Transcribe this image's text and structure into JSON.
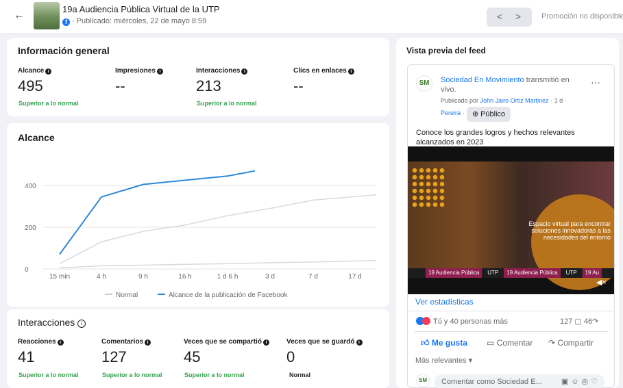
{
  "header": {
    "back": "←",
    "title": "19a Audiencia Pública Virtual de la UTP",
    "meta": "· Publicado: miércoles, 22 de mayo 8:59",
    "prev": "<",
    "next": ">",
    "promo": "Promoción no disponible"
  },
  "general": {
    "title": "Información general",
    "metrics": [
      {
        "label": "Alcance",
        "value": "495",
        "badge": "Superior a lo normal"
      },
      {
        "label": "Impresiones",
        "value": "--",
        "badge": ""
      },
      {
        "label": "Interacciones",
        "value": "213",
        "badge": "Superior a lo normal"
      },
      {
        "label": "Clics en enlaces",
        "value": "--",
        "badge": ""
      }
    ]
  },
  "reach_chart": {
    "title": "Alcance",
    "legend_normal": "Normal",
    "legend_post": "Alcance de la publicación de Facebook"
  },
  "chart_data": {
    "type": "line",
    "title": "Alcance",
    "categories": [
      "15 min",
      "4 h",
      "9 h",
      "16 h",
      "1 d 6 h",
      "3 d",
      "7 d",
      "17 d"
    ],
    "y_ticks": [
      "0",
      "200",
      "400"
    ],
    "ylim": [
      0,
      500
    ],
    "colors": {
      "post": "#2d88d8",
      "normal": "#d8dadf"
    },
    "series": [
      {
        "name": "Alcance de la publicación de Facebook",
        "values": [
          70,
          345,
          405,
          425,
          445,
          470,
          null,
          null
        ]
      },
      {
        "name": "Normal",
        "values": [
          25,
          130,
          180,
          210,
          255,
          290,
          330,
          355
        ]
      },
      {
        "name": "Normal",
        "values": [
          5,
          15,
          18,
          22,
          25,
          30,
          33,
          40
        ]
      }
    ]
  },
  "interactions": {
    "title": "Interacciones",
    "metrics": [
      {
        "label": "Reacciones",
        "value": "41",
        "badge": "Superior a lo normal",
        "neutral": false
      },
      {
        "label": "Comentarios",
        "value": "127",
        "badge": "Superior a lo normal",
        "neutral": false
      },
      {
        "label": "Veces que se compartió",
        "value": "45",
        "badge": "Superior a lo normal",
        "neutral": false
      },
      {
        "label": "Veces que se guardó",
        "value": "0",
        "badge": "Normal",
        "neutral": true
      }
    ]
  },
  "feed": {
    "title": "Vista previa del feed",
    "page_name": "Sociedad En Movimiento",
    "action_text": "transmitió en vivo.",
    "published_by": "Publicado por",
    "author": "John Jairo Ortiz Martinez",
    "time": "· 1 d ·",
    "location": "Pereira ·",
    "audience": "Público",
    "body": "Conoce los grandes logros y hechos relevantes alcanzados en 2023",
    "video_text": "Espacio virtual para encontrar soluciones innovadoras a las necesidades del entorno",
    "video_bar": [
      "19 Audiencia Pública",
      "UTP",
      "19 Audiencia Pública",
      "UTP",
      "19 Au"
    ],
    "stats_link": "Ver estadísticas",
    "reactions_text": "Tú y 40 personas más",
    "comments_count": "127",
    "shares_count": "46",
    "like": "Me gusta",
    "comment": "Comentar",
    "share": "Compartir",
    "sort": "Más relevantes ▾",
    "comment_placeholder": "Comentar como Sociedad E..."
  }
}
